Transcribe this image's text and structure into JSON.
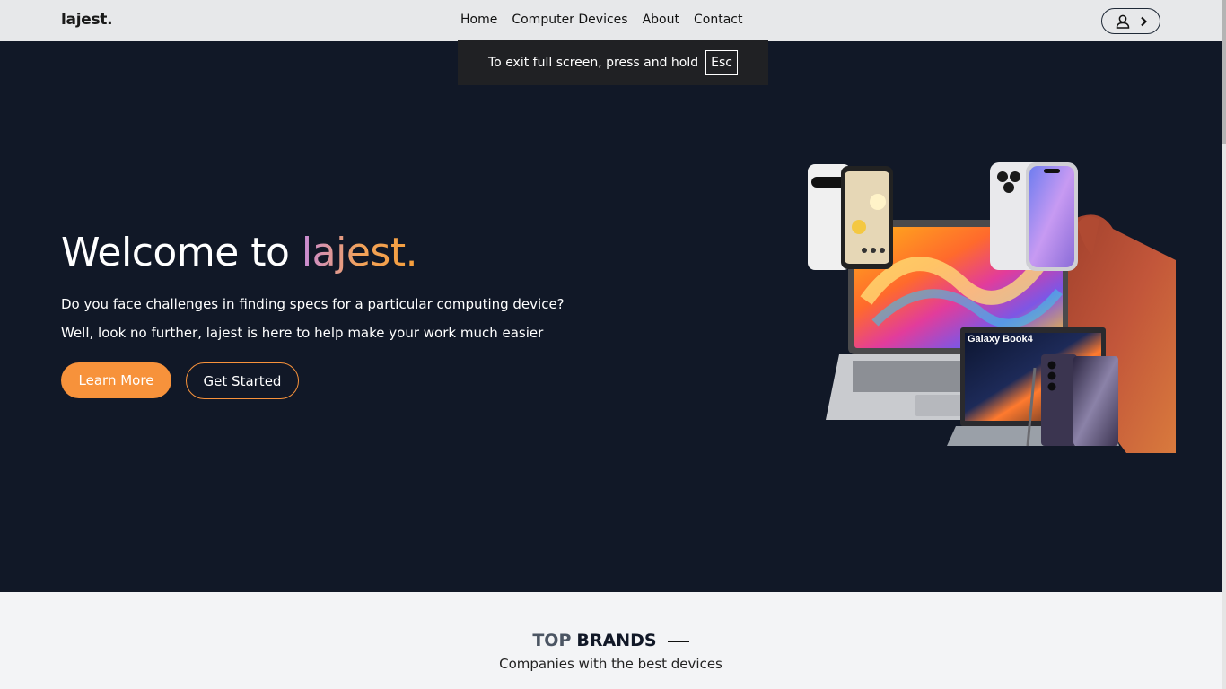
{
  "nav": {
    "logo": "lajest.",
    "links": [
      "Home",
      "Computer Devices",
      "About",
      "Contact"
    ]
  },
  "fullscreen_notice": {
    "text": "To exit full screen, press and hold",
    "key": "Esc"
  },
  "hero": {
    "title_prefix": "Welcome to ",
    "title_accent": "lajest.",
    "line1": "Do you face challenges in finding specs for a particular computing device?",
    "line2": "Well, look no further, lajest is here to help make your work much easier",
    "learn_more": "Learn More",
    "get_started": "Get Started",
    "device_labels": {
      "laptop_brand": "Galaxy Book4"
    }
  },
  "brands": {
    "title_top": "TOP",
    "title_brands": "BRANDS",
    "subtitle": "Companies with the best devices"
  },
  "colors": {
    "hero_bg": "#111827",
    "accent": "#f7923b",
    "nav_bg": "#e7e8ea"
  }
}
